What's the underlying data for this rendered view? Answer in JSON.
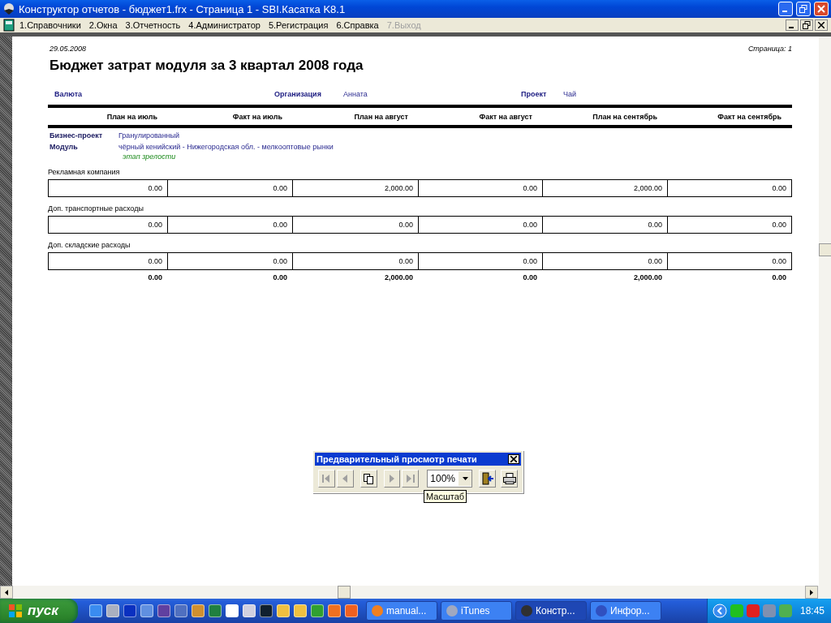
{
  "window": {
    "title": "Конструктор отчетов - бюджет1.frx - Страница 1 - SBI.Касатка K8.1"
  },
  "menu": [
    {
      "label": "1.Справочники",
      "disabled": false
    },
    {
      "label": "2.Окна",
      "disabled": false
    },
    {
      "label": "3.Отчетность",
      "disabled": false
    },
    {
      "label": "4.Администратор",
      "disabled": false
    },
    {
      "label": "5.Регистрация",
      "disabled": false
    },
    {
      "label": "6.Справка",
      "disabled": false
    },
    {
      "label": "7.Выход",
      "disabled": true
    }
  ],
  "report": {
    "date": "29.05.2008",
    "page": "Страница: 1",
    "title": "Бюджет затрат модуля за 3 квартал 2008 года",
    "header": [
      {
        "label": "Валюта"
      },
      {
        "label": "Организация",
        "value": "Анната"
      },
      {
        "label": "Проект",
        "value": "Чай"
      }
    ],
    "columns": [
      "План на июль",
      "Факт на июль",
      "План на август",
      "Факт на август",
      "План на сентябрь",
      "Факт на сентябрь"
    ],
    "info": [
      {
        "label": "Бизнес-проект",
        "value": "Гранулированный"
      },
      {
        "label": "Модуль",
        "value": "чёрный кенийский - Нижегородская обл. - мелкооптовые рынки"
      }
    ],
    "stage": "этап зрелости",
    "sections": [
      {
        "label": "Рекламная компания",
        "values": [
          "0.00",
          "0.00",
          "2,000.00",
          "0.00",
          "2,000.00",
          "0.00"
        ]
      },
      {
        "label": "Доп. транспортные расходы",
        "values": [
          "0.00",
          "0.00",
          "0.00",
          "0.00",
          "0.00",
          "0.00"
        ]
      },
      {
        "label": "Доп. складские расходы",
        "values": [
          "0.00",
          "0.00",
          "0.00",
          "0.00",
          "0.00",
          "0.00"
        ]
      }
    ],
    "totals": [
      "0.00",
      "0.00",
      "2,000.00",
      "0.00",
      "2,000.00",
      "0.00"
    ]
  },
  "preview_toolbar": {
    "title": "Предварительный просмотр печати",
    "zoom": "100%",
    "tooltip": "Масштаб",
    "buttons": [
      {
        "kind": "first",
        "disabled": true
      },
      {
        "kind": "prev",
        "disabled": true
      },
      {
        "kind": "pages",
        "disabled": false
      },
      {
        "kind": "next",
        "disabled": true
      },
      {
        "kind": "last",
        "disabled": true
      }
    ]
  },
  "taskbar": {
    "start": "пуск",
    "tasks": [
      {
        "label": "manual...",
        "selected": false
      },
      {
        "label": "iTunes",
        "selected": false
      },
      {
        "label": "Констр...",
        "selected": true
      },
      {
        "label": "Инфор...",
        "selected": false
      }
    ],
    "clock": "18:45"
  }
}
